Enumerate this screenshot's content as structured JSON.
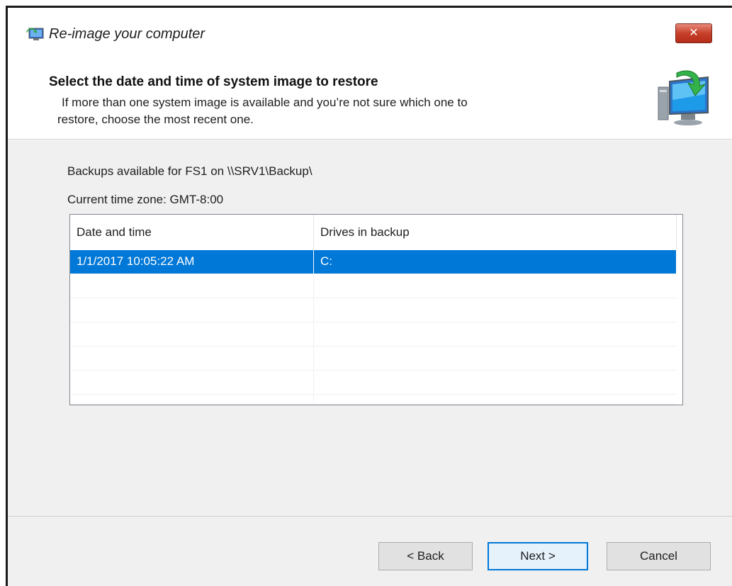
{
  "window": {
    "title": "Re-image your computer",
    "close_label": "✕"
  },
  "header": {
    "title": "Select the date and time of system image to restore",
    "desc_line1": "If more than one system image is available and you’re not sure which one to",
    "desc_line2": "restore, choose the most recent one."
  },
  "main": {
    "backups_label": "Backups available for FS1 on \\\\SRV1\\Backup\\",
    "timezone_label": "Current time zone: GMT-8:00",
    "table": {
      "columns": [
        "Date and time",
        "Drives in backup"
      ],
      "rows": [
        {
          "date": "1/1/2017 10:05:22 AM",
          "drives": "C:",
          "selected": true
        }
      ]
    }
  },
  "footer": {
    "back_label": "< Back",
    "next_label": "Next >",
    "cancel_label": "Cancel"
  },
  "colors": {
    "selection": "#0078d7",
    "close_button": "#c6402a",
    "panel_bg": "#f0f0f0"
  }
}
